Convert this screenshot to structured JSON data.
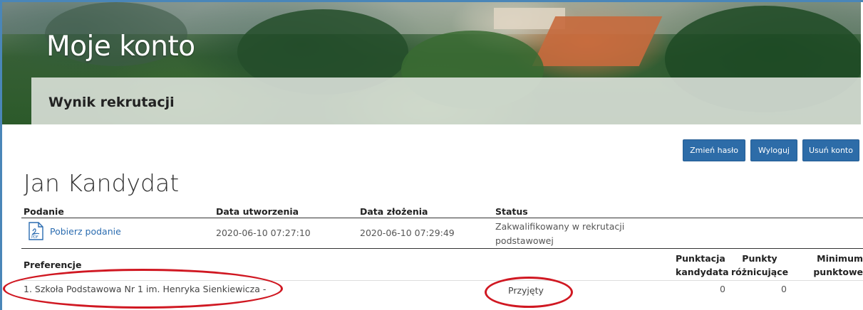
{
  "header": {
    "title": "Moje konto",
    "subtitle": "Wynik rekrutacji"
  },
  "buttons": {
    "change_password": "Zmień hasło",
    "logout": "Wyloguj",
    "delete_account": "Usuń konto"
  },
  "candidate_name": "Jan Kandydat",
  "application_table": {
    "headers": {
      "application": "Podanie",
      "created": "Data utworzenia",
      "submitted": "Data złożenia",
      "status": "Status"
    },
    "row": {
      "download_label": "Pobierz podanie",
      "pdf_icon_text": "PDF",
      "created": "2020-06-10 07:27:10",
      "submitted": "2020-06-10 07:29:49",
      "status_line1": "Zakwalifikowany w rekrutacji",
      "status_line2": "podstawowej"
    }
  },
  "preferences_table": {
    "headers": {
      "preferences": "Preferencje",
      "score_line1": "Punktacja",
      "score_line2": "kandydata",
      "diff_line1": "Punkty",
      "diff_line2": "różnicujące",
      "min_line1": "Minimum",
      "min_line2": "punktowe"
    },
    "rows": [
      {
        "school": "1. Szkoła Podstawowa Nr 1 im. Henryka Sienkiewicza -",
        "status": "Przyjęty",
        "score": "0",
        "diff_points": "0"
      }
    ]
  },
  "colors": {
    "accent": "#2d6ca8",
    "highlight_oval": "#d01822",
    "frame": "#4a86b8"
  }
}
